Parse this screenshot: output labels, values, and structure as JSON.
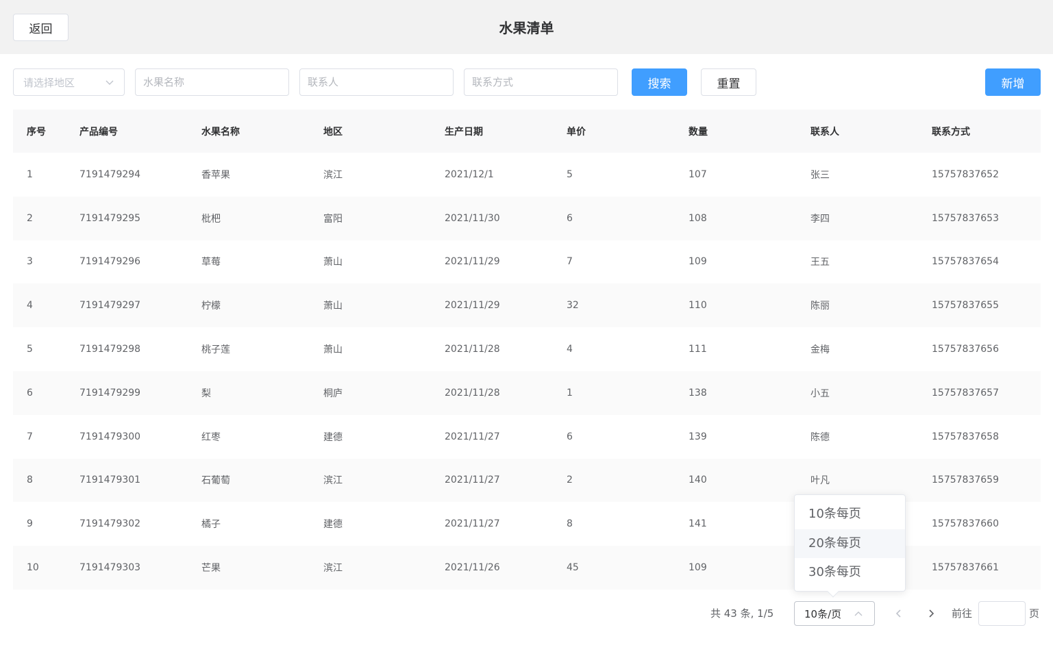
{
  "header": {
    "back_label": "返回",
    "title": "水果清单"
  },
  "filters": {
    "region_placeholder": "请选择地区",
    "fruit_name_placeholder": "水果名称",
    "contact_placeholder": "联系人",
    "phone_placeholder": "联系方式",
    "search_label": "搜索",
    "reset_label": "重置",
    "add_label": "新增"
  },
  "table": {
    "columns": [
      "序号",
      "产品编号",
      "水果名称",
      "地区",
      "生产日期",
      "单价",
      "数量",
      "联系人",
      "联系方式"
    ],
    "rows": [
      [
        "1",
        "7191479294",
        "香苹果",
        "滨江",
        "2021/12/1",
        "5",
        "107",
        "张三",
        "15757837652"
      ],
      [
        "2",
        "7191479295",
        "枇杷",
        "富阳",
        "2021/11/30",
        "6",
        "108",
        "李四",
        "15757837653"
      ],
      [
        "3",
        "7191479296",
        "草莓",
        "萧山",
        "2021/11/29",
        "7",
        "109",
        "王五",
        "15757837654"
      ],
      [
        "4",
        "7191479297",
        "柠檬",
        "萧山",
        "2021/11/29",
        "32",
        "110",
        "陈丽",
        "15757837655"
      ],
      [
        "5",
        "7191479298",
        "桃子莲",
        "萧山",
        "2021/11/28",
        "4",
        "111",
        "金梅",
        "15757837656"
      ],
      [
        "6",
        "7191479299",
        "梨",
        "桐庐",
        "2021/11/28",
        "1",
        "138",
        "小五",
        "15757837657"
      ],
      [
        "7",
        "7191479300",
        "红枣",
        "建德",
        "2021/11/27",
        "6",
        "139",
        "陈德",
        "15757837658"
      ],
      [
        "8",
        "7191479301",
        "石葡萄",
        "滨江",
        "2021/11/27",
        "2",
        "140",
        "叶凡",
        "15757837659"
      ],
      [
        "9",
        "7191479302",
        "橘子",
        "建德",
        "2021/11/27",
        "8",
        "141",
        "",
        "15757837660"
      ],
      [
        "10",
        "7191479303",
        "芒果",
        "滨江",
        "2021/11/26",
        "45",
        "109",
        "",
        "15757837661"
      ]
    ]
  },
  "pagination": {
    "total_text": "共 43 条, 1/5",
    "page_size_label": "10条/页",
    "goto_label": "前往",
    "page_suffix": "页",
    "page_size_options": [
      "10条每页",
      "20条每页",
      "30条每页"
    ]
  },
  "colors": {
    "primary": "#409eff",
    "header_bg": "#f2f2f2",
    "table_stripe": "#fafafa"
  },
  "icons": {
    "region_select": "chevron-down-icon",
    "page_size_select": "chevron-up-icon",
    "prev": "chevron-left-icon",
    "next": "chevron-right-icon"
  }
}
